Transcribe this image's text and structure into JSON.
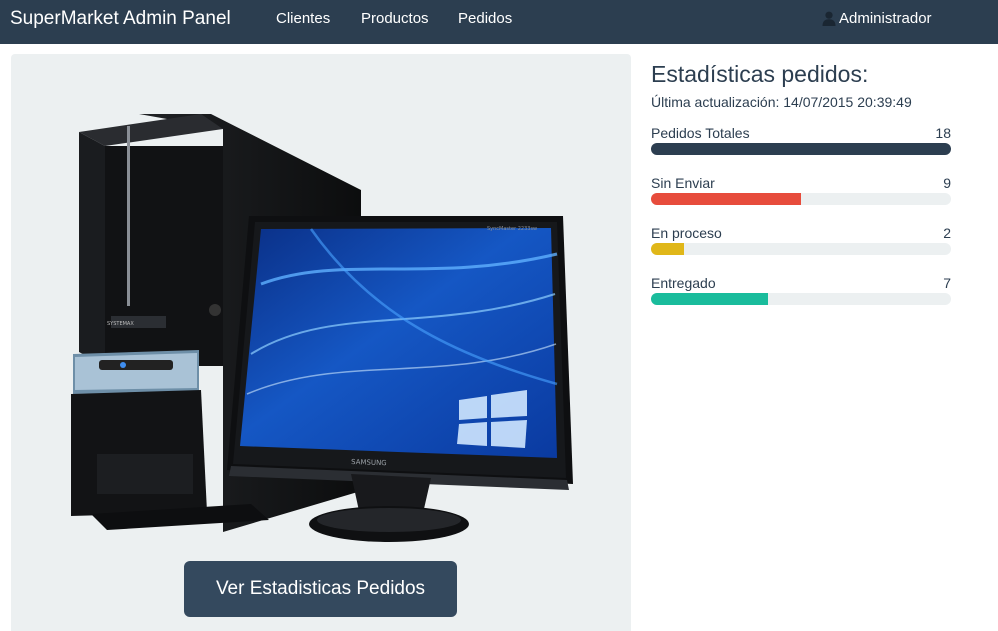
{
  "navbar": {
    "brand": "SuperMarket Admin Panel",
    "links": [
      "Clientes",
      "Productos",
      "Pedidos"
    ],
    "user": "Administrador",
    "user_icon": "user-icon"
  },
  "hero": {
    "image": "desktop-computer-with-monitor",
    "monitor_brand": "SAMSUNG",
    "monitor_model": "SyncMaster 2233sw",
    "tower_brand": "SYSTEMAX",
    "button_label": "Ver Estadisticas Pedidos"
  },
  "stats": {
    "title": "Estadísticas pedidos:",
    "last_update": "Última actualización: 14/07/2015 20:39:49",
    "items": [
      {
        "label": "Pedidos Totales",
        "value": "18",
        "progress": 1.0,
        "color": "#2c3e50"
      },
      {
        "label": "Sin Enviar",
        "value": "9",
        "progress": 0.5,
        "color": "#e74c3c"
      },
      {
        "label": "En proceso",
        "value": "2",
        "progress": 0.111,
        "color": "#e0b719"
      },
      {
        "label": "Entregado",
        "value": "7",
        "progress": 0.389,
        "color": "#1abc9c"
      }
    ]
  }
}
